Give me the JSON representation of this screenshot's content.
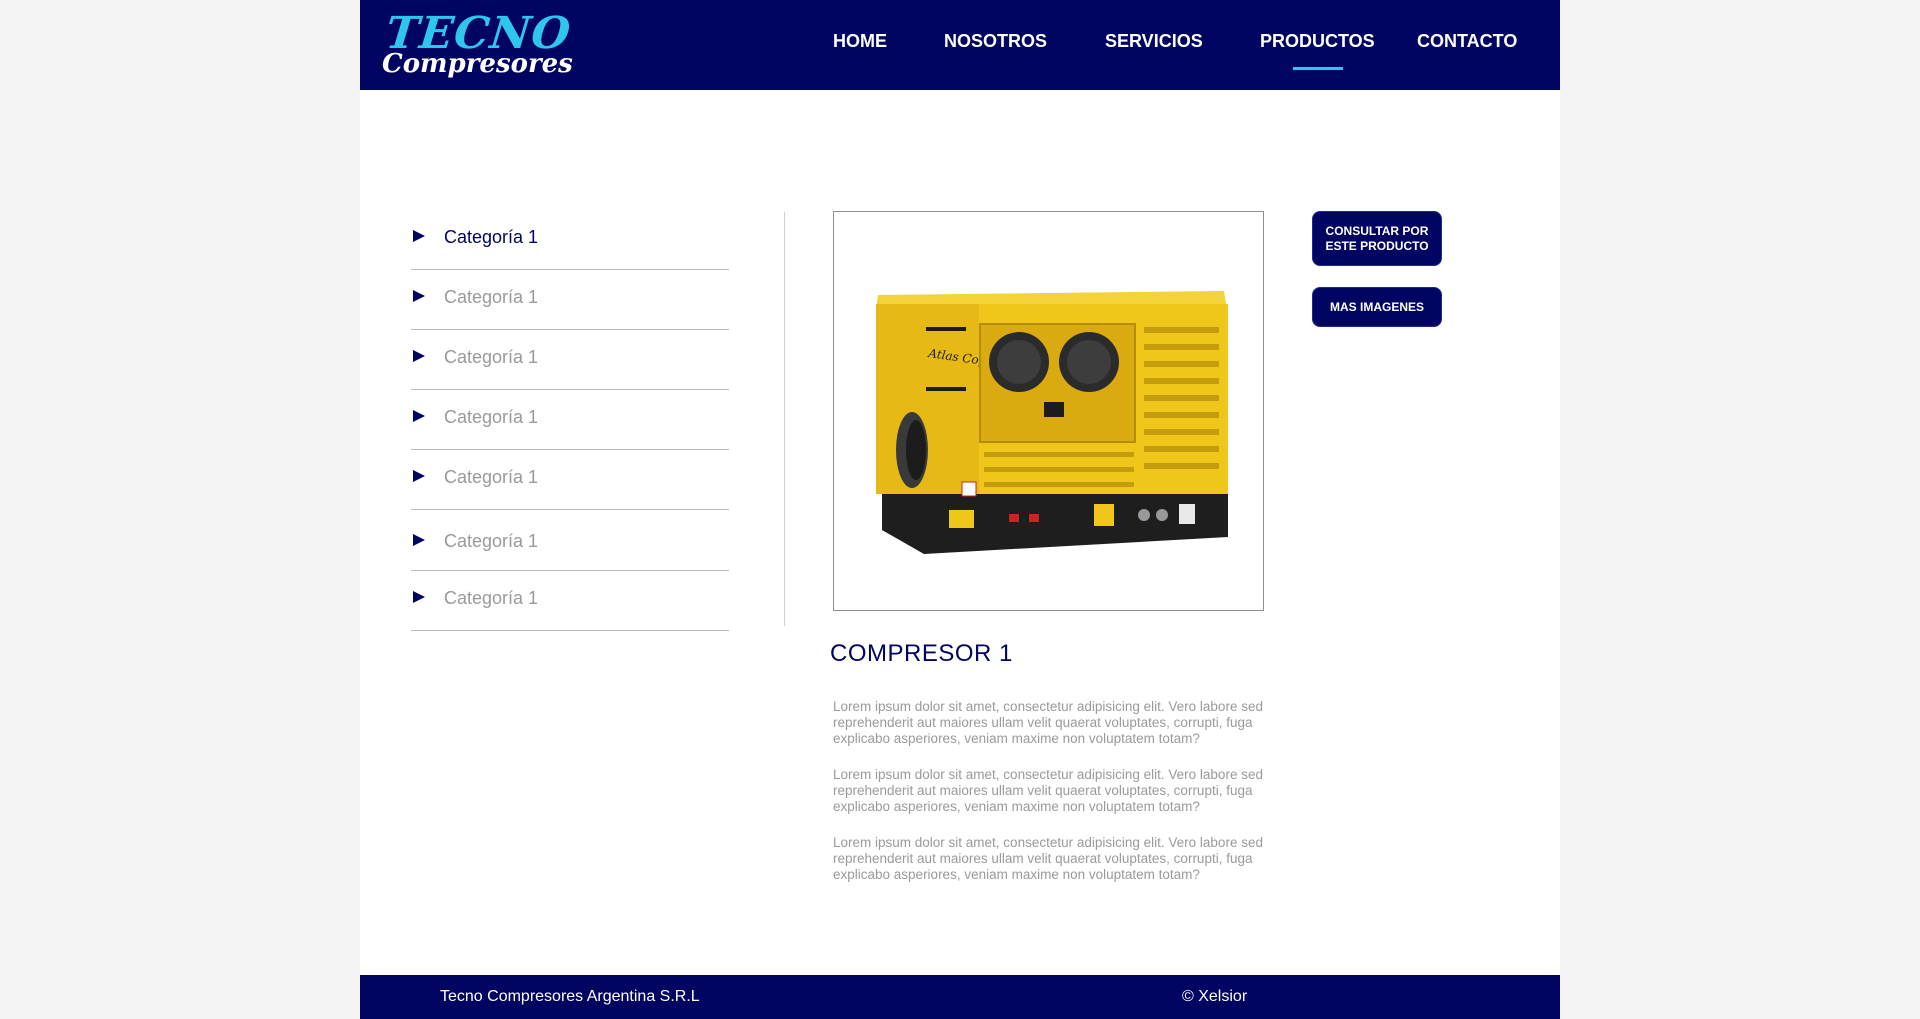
{
  "brand": {
    "line1": "TECNO",
    "line2": "Compresores",
    "primary_color": "#020461",
    "accent_color": "#2fc6ee"
  },
  "nav": {
    "items": [
      {
        "label": "HOME"
      },
      {
        "label": "NOSOTROS"
      },
      {
        "label": "SERVICIOS"
      },
      {
        "label": "PRODUCTOS"
      },
      {
        "label": "CONTACTO"
      }
    ],
    "active": "PRODUCTOS"
  },
  "sidebar": {
    "items": [
      {
        "label": "Categoría 1"
      },
      {
        "label": "Categoría 1"
      },
      {
        "label": "Categoría 1"
      },
      {
        "label": "Categoría 1"
      },
      {
        "label": "Categoría 1"
      },
      {
        "label": "Categoría 1"
      },
      {
        "label": "Categoría 1"
      }
    ]
  },
  "product": {
    "title": "COMPRESOR 1",
    "image_brand_text": "Atlas Copco",
    "paragraphs": [
      "Lorem ipsum dolor sit amet, consectetur adipisicing elit. Vero labore sed reprehenderit aut maiores ullam velit quaerat voluptates, corrupti, fuga explicabo asperiores, veniam maxime non voluptatem totam?",
      "Lorem ipsum dolor sit amet, consectetur adipisicing elit. Vero labore sed reprehenderit aut maiores ullam velit quaerat voluptates, corrupti, fuga explicabo asperiores, veniam maxime non voluptatem totam?",
      "Lorem ipsum dolor sit amet, consectetur adipisicing elit. Vero labore sed reprehenderit aut maiores ullam velit quaerat voluptates, corrupti, fuga explicabo asperiores, veniam maxime non voluptatem totam?"
    ]
  },
  "actions": {
    "consult_line1": "CONSULTAR POR",
    "consult_line2": "ESTE PRODUCTO",
    "more_images": "MAS IMAGENES"
  },
  "footer": {
    "company": "Tecno Compresores Argentina S.R.L",
    "credit": "© Xelsior"
  }
}
